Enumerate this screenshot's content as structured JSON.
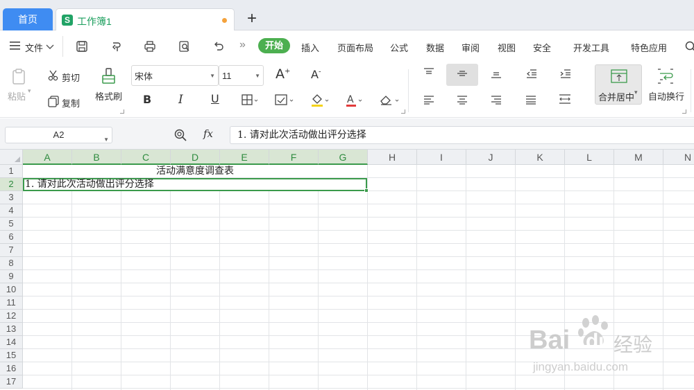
{
  "tabs": {
    "home_label": "首页",
    "doc_icon": "S",
    "doc_title": "工作簿1",
    "add_label": "+"
  },
  "menu": {
    "file_label": "文件",
    "expand_label": "»",
    "items": [
      "开始",
      "插入",
      "页面布局",
      "公式",
      "数据",
      "审阅",
      "视图",
      "安全",
      "开发工具",
      "特色应用"
    ],
    "active_index": 0
  },
  "ribbon": {
    "paste_label": "粘贴",
    "cut_label": "剪切",
    "copy_label": "复制",
    "format_painter_label": "格式刷",
    "font_name": "宋体",
    "font_size": "11",
    "increase_font_label": "A",
    "decrease_font_label": "A",
    "bold_label": "B",
    "italic_label": "I",
    "underline_label": "U",
    "merge_center_label": "合并居中",
    "wrap_text_label": "自动换行"
  },
  "formula_bar": {
    "name_box": "A2",
    "fx_label": "fx",
    "formula_value": "1. 请对此次活动做出评分选择"
  },
  "sheet": {
    "columns": [
      "A",
      "B",
      "C",
      "D",
      "E",
      "F",
      "G",
      "H",
      "I",
      "J",
      "K",
      "L",
      "M",
      "N"
    ],
    "rows": [
      "1",
      "2",
      "3",
      "4",
      "5",
      "6",
      "7",
      "8",
      "9",
      "10",
      "11",
      "12",
      "13",
      "14",
      "15",
      "16",
      "17"
    ],
    "selected_column_range": [
      "A",
      "G"
    ],
    "selected_row": "2",
    "merged_title": "活动满意度调查表",
    "cell_a2": "1. 请对此次活动做出评分选择"
  },
  "watermark": {
    "brand": "Bai",
    "brand_tail": "du",
    "suffix": "经验",
    "url": "jingyan.baidu.com"
  },
  "colors": {
    "accent_green": "#4caf50",
    "selection_green": "#3a9a4b",
    "home_tab_blue": "#3f8cf2",
    "modified_dot": "#f4a23c"
  }
}
